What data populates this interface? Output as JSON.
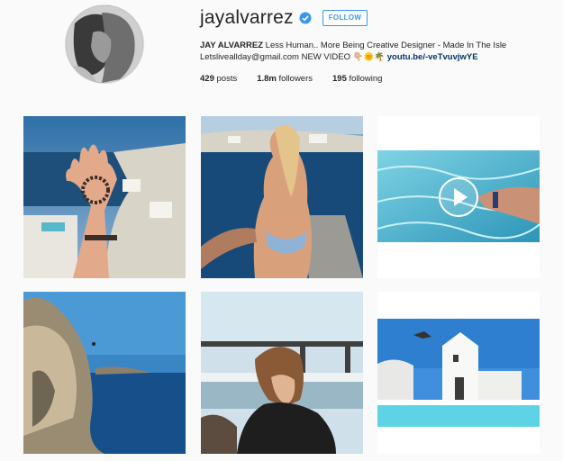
{
  "profile": {
    "username": "jayalvarrez",
    "follow_label": "FOLLOW",
    "bio_name": "JAY ALVARREZ",
    "bio_line1_rest": " Less Human.. More Being Creative Designer - Made In The Isle",
    "bio_line2_text": "Letsliveallday@gmail.com NEW VIDEO ",
    "bio_emojis": "👇🏼🌞🌴",
    "bio_link": "youtu.be/-veTvuvjwYE",
    "posts_count": "429",
    "posts_label": " posts",
    "followers_count": "1.8m",
    "followers_label": " followers",
    "following_count": "195",
    "following_label": " following"
  },
  "colors": {
    "accent": "#3897f0",
    "link": "#003569",
    "background": "#fafafa"
  },
  "icons": {
    "verified": "verified-badge-icon",
    "play": "play-icon"
  }
}
